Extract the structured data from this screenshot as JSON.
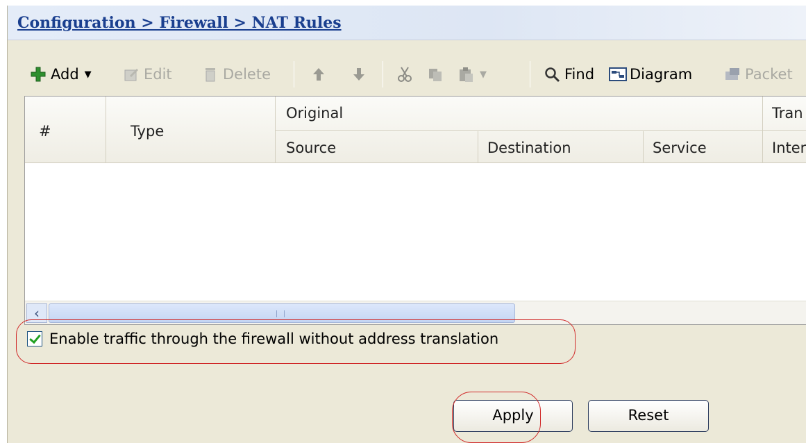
{
  "breadcrumb": "Configuration > Firewall > NAT Rules",
  "toolbar": {
    "add": "Add",
    "edit": "Edit",
    "delete": "Delete",
    "find": "Find",
    "diagram": "Diagram",
    "packet": "Packet"
  },
  "table": {
    "col_num": "#",
    "col_type": "Type",
    "group_original": "Original",
    "group_translated": "Tran",
    "col_source": "Source",
    "col_destination": "Destination",
    "col_service": "Service",
    "col_interface": "Inter",
    "rows": []
  },
  "options": {
    "enable_traffic_label": "Enable traffic through the firewall without address translation",
    "enable_traffic_checked": true
  },
  "buttons": {
    "apply": "Apply",
    "reset": "Reset"
  },
  "colors": {
    "highlight": "#d02828",
    "breadcrumb": "#1a3f8f"
  }
}
